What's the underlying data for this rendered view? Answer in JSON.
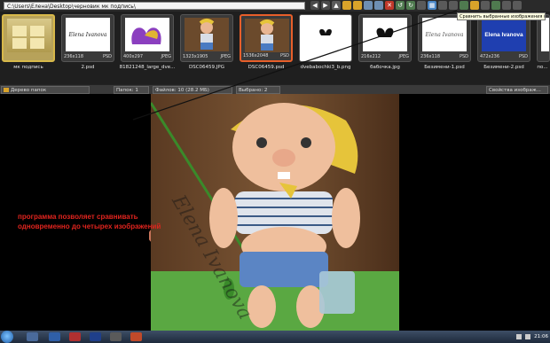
{
  "address_bar": {
    "path": "C:\\Users\\Елена\\Desktop\\черновик мк подпись\\"
  },
  "tooltip": {
    "text": "Сравнить выбранные изображения (до четырёх одновременно)"
  },
  "thumbnails": [
    {
      "name": "мк подпись",
      "dims": "",
      "format": "",
      "state": "highlight"
    },
    {
      "name": "2.psd",
      "dims": "236x118",
      "format": "PSD",
      "state": "normal"
    },
    {
      "name": "81821248_large_dve...",
      "dims": "400x297",
      "format": "JPEG",
      "state": "normal"
    },
    {
      "name": "DSC06459.JPG",
      "dims": "1323x1905",
      "format": "JPEG",
      "state": "normal"
    },
    {
      "name": "DSC06459.psd",
      "dims": "1536x2048",
      "format": "PSD",
      "state": "selected"
    },
    {
      "name": "dvebabochki3_b.png",
      "dims": "",
      "format": "",
      "state": "normal"
    },
    {
      "name": "бабочка.jpg",
      "dims": "216x212",
      "format": "JPEG",
      "state": "normal"
    },
    {
      "name": "Безимени-1.psd",
      "dims": "236x118",
      "format": "PSD",
      "state": "normal"
    },
    {
      "name": "Безимени-2.psd",
      "dims": "472x236",
      "format": "PSD",
      "state": "normal"
    },
    {
      "name": "по...",
      "dims": "",
      "format": "",
      "state": "normal"
    }
  ],
  "thumb_texts": {
    "elena_script": "Elena Ivanova",
    "elena_blue": "Elena Ivanova"
  },
  "status_bar": {
    "tree_label": "Дерево папок",
    "folders": "Папок: 1",
    "files": "Файлов: 10 (28.2 МБ)",
    "selected": "Выбрано: 2",
    "props": "Свойства изображ..."
  },
  "annotation": {
    "text": "программа позволяет сравнивать одновременно до четырех изображений"
  },
  "photo": {
    "watermark": "Elena Ivanova"
  },
  "taskbar": {
    "clock": "21:06"
  },
  "colors": {
    "accent_selected": "#e85f2a",
    "annotation": "#e0241e",
    "highlight": "#d7b84a"
  }
}
